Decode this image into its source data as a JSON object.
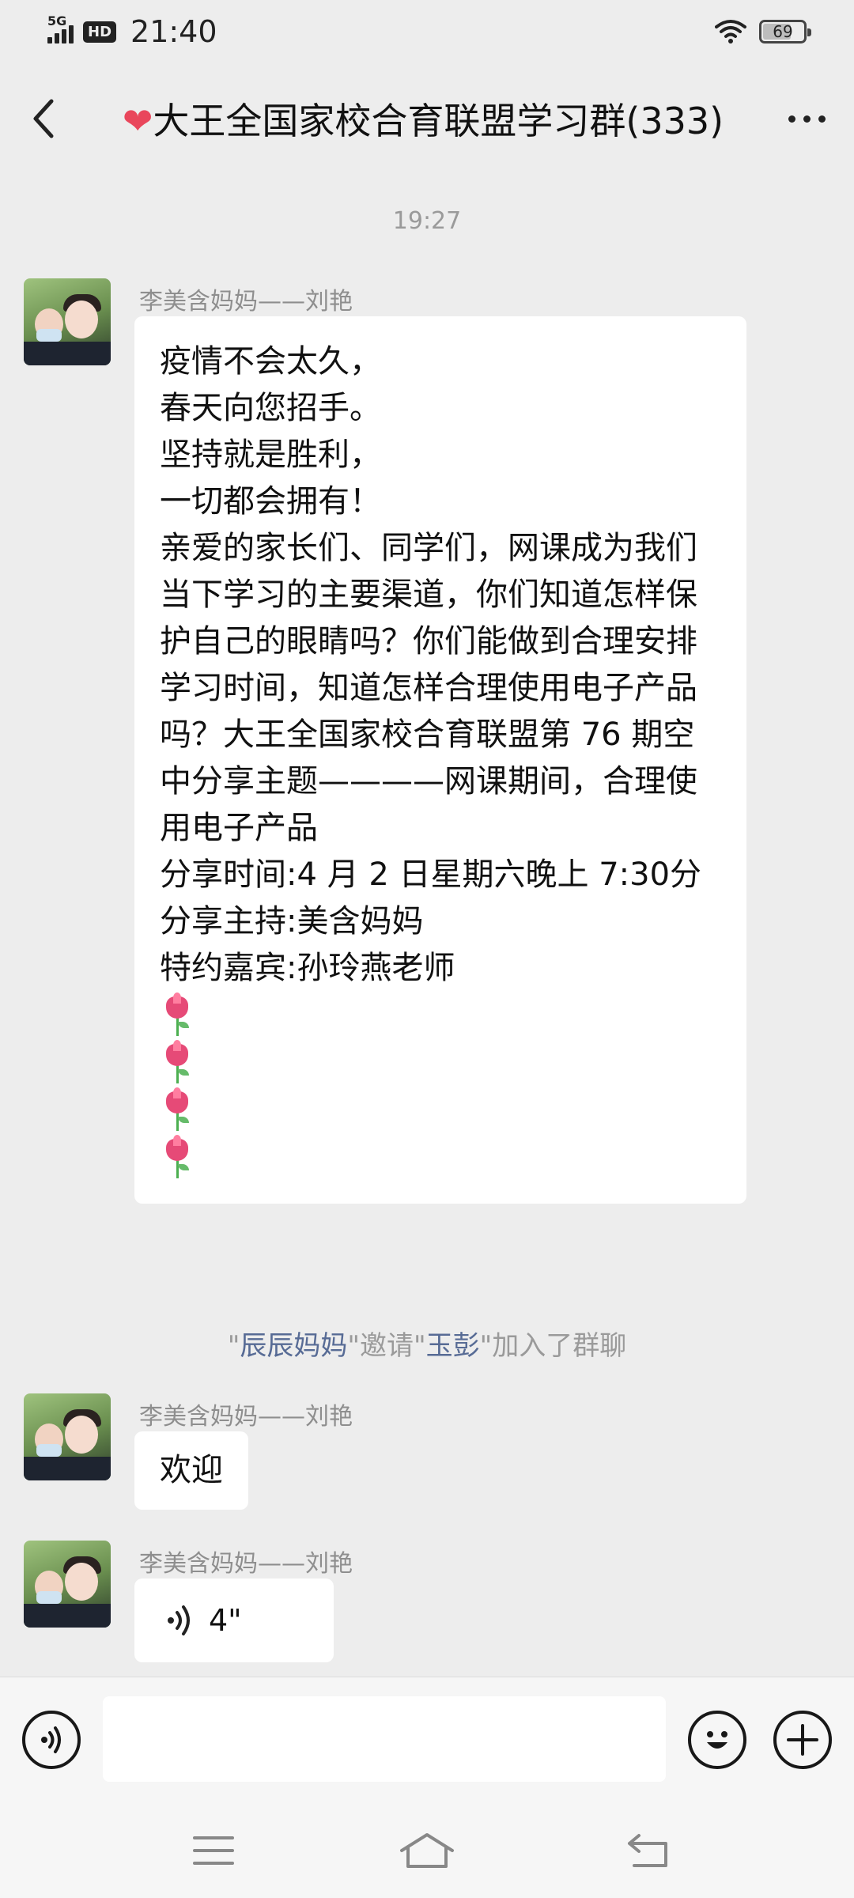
{
  "status_bar": {
    "network": "5G",
    "hd": "HD",
    "time": "21:40",
    "battery": "69",
    "battery_level": 0.69
  },
  "header": {
    "title_prefix": "❤",
    "title": "大王全国家校合育联盟学习群(333)"
  },
  "chat": {
    "timestamp": "19:27",
    "messages": [
      {
        "sender": "李美含妈妈——刘艳",
        "text": "疫情不会太久，\n春天向您招手。\n坚持就是胜利，\n一切都会拥有！\n亲爱的家长们、同学们，网课成为我们当下学习的主要渠道，你们知道怎样保护自己的眼睛吗？你们能做到合理安排学习时间，知道怎样合理使用电子产品吗？大王全国家校合育联盟第 76 期空中分享主题————网课期间，合理使用电子产品\n分享时间:4 月 2 日星期六晚上 7:30分\n分享主持:美含妈妈\n特约嘉宾:孙玲燕老师",
        "emoji_count": 4,
        "emoji": "tulip-icon"
      },
      {
        "sender": "李美含妈妈——刘艳",
        "text": "欢迎"
      },
      {
        "sender": "李美含妈妈——刘艳",
        "voice_duration": "4\""
      }
    ],
    "system_note": {
      "q1": "\"",
      "inviter": "辰辰妈妈",
      "mid": "\"邀请\"",
      "invitee": "玉彭",
      "tail": "\"加入了群聊"
    }
  },
  "input": {
    "value": "",
    "placeholder": ""
  },
  "colors": {
    "background": "#ededed",
    "bubble": "#ffffff",
    "name_link": "#576b95",
    "heart": "#e9465b"
  }
}
